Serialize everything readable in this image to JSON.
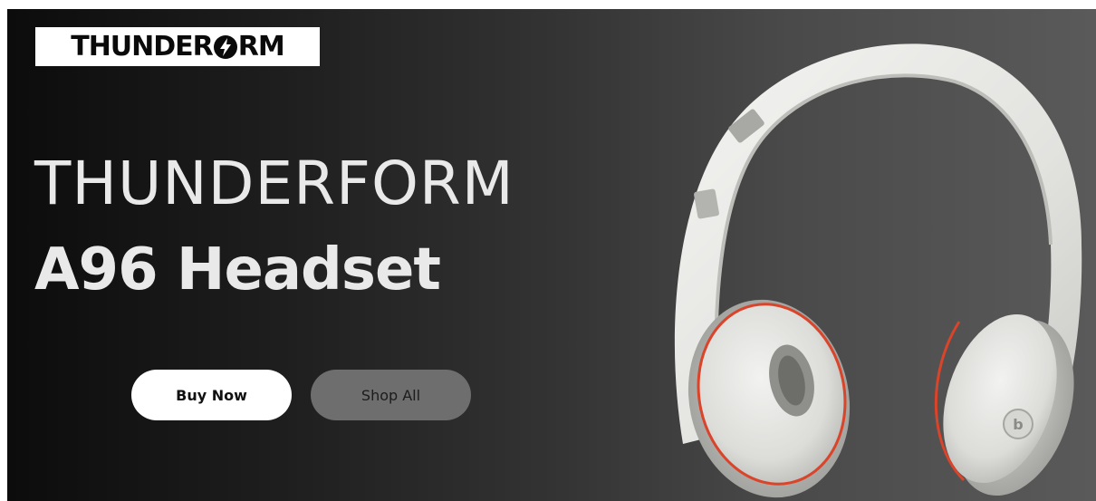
{
  "brand": {
    "logo_prefix": "THUNDER",
    "logo_suffix": "RM"
  },
  "hero": {
    "title": "THUNDERFORM",
    "product_name": "A96 Headset"
  },
  "actions": {
    "buy_label": "Buy Now",
    "shop_label": "Shop All"
  },
  "colors": {
    "background_dark": "#0c0c0c",
    "background_light": "#5a5a5a",
    "text": "#e9e9e9",
    "buy_button": "#ffffff",
    "shop_button": "#6e6e6e",
    "accent_red": "#d9442a"
  },
  "icons": {
    "logo_mark": "lightning-bolt-icon",
    "product_image": "headphones-image"
  }
}
